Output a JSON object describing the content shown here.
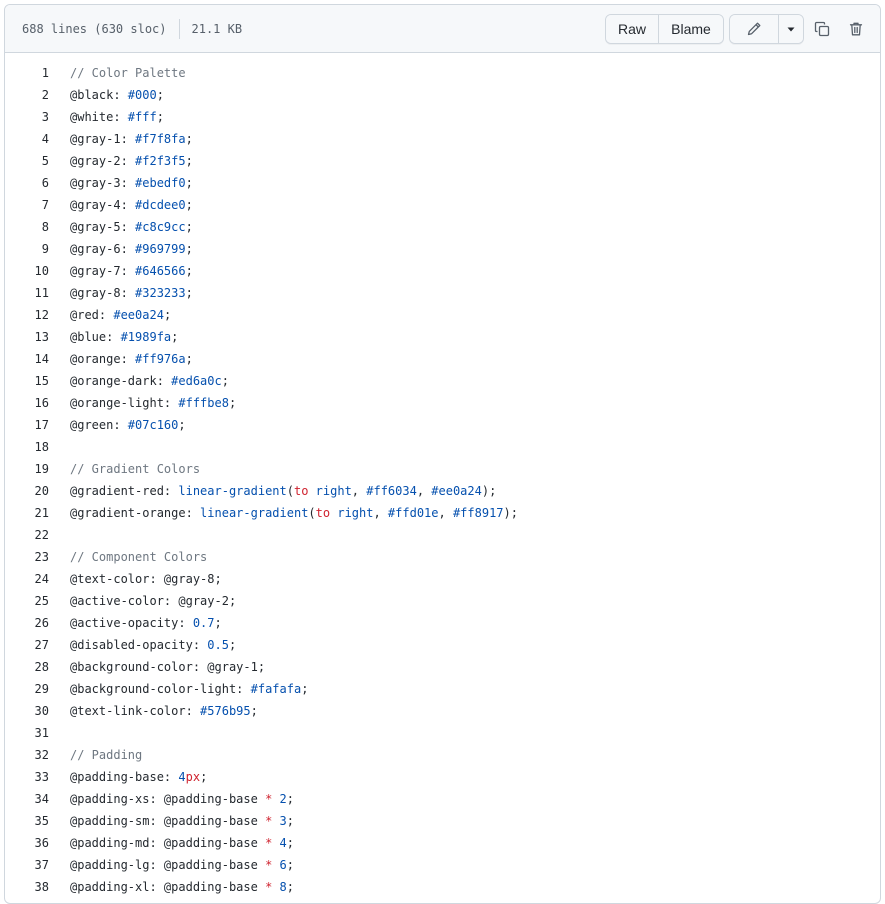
{
  "file_info": {
    "lines": "688 lines (630 sloc)",
    "size": "21.1 KB"
  },
  "toolbar": {
    "raw_label": "Raw",
    "blame_label": "Blame",
    "edit_icon": "pencil-icon",
    "more_icon": "triangle-down-icon",
    "copy_icon": "copy-icon",
    "delete_icon": "trash-icon"
  },
  "code_lines": [
    {
      "n": "1",
      "tokens": [
        {
          "t": "// Color Palette",
          "k": "c"
        }
      ]
    },
    {
      "n": "2",
      "tokens": [
        {
          "t": "@black: ",
          "k": "v"
        },
        {
          "t": "#000",
          "k": "n"
        },
        {
          "t": ";",
          "k": "v"
        }
      ]
    },
    {
      "n": "3",
      "tokens": [
        {
          "t": "@white: ",
          "k": "v"
        },
        {
          "t": "#fff",
          "k": "n"
        },
        {
          "t": ";",
          "k": "v"
        }
      ]
    },
    {
      "n": "4",
      "tokens": [
        {
          "t": "@gray-1: ",
          "k": "v"
        },
        {
          "t": "#f7f8fa",
          "k": "n"
        },
        {
          "t": ";",
          "k": "v"
        }
      ]
    },
    {
      "n": "5",
      "tokens": [
        {
          "t": "@gray-2: ",
          "k": "v"
        },
        {
          "t": "#f2f3f5",
          "k": "n"
        },
        {
          "t": ";",
          "k": "v"
        }
      ]
    },
    {
      "n": "6",
      "tokens": [
        {
          "t": "@gray-3: ",
          "k": "v"
        },
        {
          "t": "#ebedf0",
          "k": "n"
        },
        {
          "t": ";",
          "k": "v"
        }
      ]
    },
    {
      "n": "7",
      "tokens": [
        {
          "t": "@gray-4: ",
          "k": "v"
        },
        {
          "t": "#dcdee0",
          "k": "n"
        },
        {
          "t": ";",
          "k": "v"
        }
      ]
    },
    {
      "n": "8",
      "tokens": [
        {
          "t": "@gray-5: ",
          "k": "v"
        },
        {
          "t": "#c8c9cc",
          "k": "n"
        },
        {
          "t": ";",
          "k": "v"
        }
      ]
    },
    {
      "n": "9",
      "tokens": [
        {
          "t": "@gray-6: ",
          "k": "v"
        },
        {
          "t": "#969799",
          "k": "n"
        },
        {
          "t": ";",
          "k": "v"
        }
      ]
    },
    {
      "n": "10",
      "tokens": [
        {
          "t": "@gray-7: ",
          "k": "v"
        },
        {
          "t": "#646566",
          "k": "n"
        },
        {
          "t": ";",
          "k": "v"
        }
      ]
    },
    {
      "n": "11",
      "tokens": [
        {
          "t": "@gray-8: ",
          "k": "v"
        },
        {
          "t": "#323233",
          "k": "n"
        },
        {
          "t": ";",
          "k": "v"
        }
      ]
    },
    {
      "n": "12",
      "tokens": [
        {
          "t": "@red: ",
          "k": "v"
        },
        {
          "t": "#ee0a24",
          "k": "n"
        },
        {
          "t": ";",
          "k": "v"
        }
      ]
    },
    {
      "n": "13",
      "tokens": [
        {
          "t": "@blue: ",
          "k": "v"
        },
        {
          "t": "#1989fa",
          "k": "n"
        },
        {
          "t": ";",
          "k": "v"
        }
      ]
    },
    {
      "n": "14",
      "tokens": [
        {
          "t": "@orange: ",
          "k": "v"
        },
        {
          "t": "#ff976a",
          "k": "n"
        },
        {
          "t": ";",
          "k": "v"
        }
      ]
    },
    {
      "n": "15",
      "tokens": [
        {
          "t": "@orange-dark: ",
          "k": "v"
        },
        {
          "t": "#ed6a0c",
          "k": "n"
        },
        {
          "t": ";",
          "k": "v"
        }
      ]
    },
    {
      "n": "16",
      "tokens": [
        {
          "t": "@orange-light: ",
          "k": "v"
        },
        {
          "t": "#fffbe8",
          "k": "n"
        },
        {
          "t": ";",
          "k": "v"
        }
      ]
    },
    {
      "n": "17",
      "tokens": [
        {
          "t": "@green: ",
          "k": "v"
        },
        {
          "t": "#07c160",
          "k": "n"
        },
        {
          "t": ";",
          "k": "v"
        }
      ]
    },
    {
      "n": "18",
      "tokens": []
    },
    {
      "n": "19",
      "tokens": [
        {
          "t": "// Gradient Colors",
          "k": "c"
        }
      ]
    },
    {
      "n": "20",
      "tokens": [
        {
          "t": "@gradient-red: ",
          "k": "v"
        },
        {
          "t": "linear-gradient",
          "k": "f"
        },
        {
          "t": "(",
          "k": "v"
        },
        {
          "t": "to",
          "k": "o"
        },
        {
          "t": " ",
          "k": "v"
        },
        {
          "t": "right",
          "k": "f"
        },
        {
          "t": ", ",
          "k": "v"
        },
        {
          "t": "#ff6034",
          "k": "n"
        },
        {
          "t": ", ",
          "k": "v"
        },
        {
          "t": "#ee0a24",
          "k": "n"
        },
        {
          "t": ");",
          "k": "v"
        }
      ]
    },
    {
      "n": "21",
      "tokens": [
        {
          "t": "@gradient-orange: ",
          "k": "v"
        },
        {
          "t": "linear-gradient",
          "k": "f"
        },
        {
          "t": "(",
          "k": "v"
        },
        {
          "t": "to",
          "k": "o"
        },
        {
          "t": " ",
          "k": "v"
        },
        {
          "t": "right",
          "k": "f"
        },
        {
          "t": ", ",
          "k": "v"
        },
        {
          "t": "#ffd01e",
          "k": "n"
        },
        {
          "t": ", ",
          "k": "v"
        },
        {
          "t": "#ff8917",
          "k": "n"
        },
        {
          "t": ");",
          "k": "v"
        }
      ]
    },
    {
      "n": "22",
      "tokens": []
    },
    {
      "n": "23",
      "tokens": [
        {
          "t": "// Component Colors",
          "k": "c"
        }
      ]
    },
    {
      "n": "24",
      "tokens": [
        {
          "t": "@text-color: @gray-8;",
          "k": "v"
        }
      ]
    },
    {
      "n": "25",
      "tokens": [
        {
          "t": "@active-color: @gray-2;",
          "k": "v"
        }
      ]
    },
    {
      "n": "26",
      "tokens": [
        {
          "t": "@active-opacity: ",
          "k": "v"
        },
        {
          "t": "0.7",
          "k": "n"
        },
        {
          "t": ";",
          "k": "v"
        }
      ]
    },
    {
      "n": "27",
      "tokens": [
        {
          "t": "@disabled-opacity: ",
          "k": "v"
        },
        {
          "t": "0.5",
          "k": "n"
        },
        {
          "t": ";",
          "k": "v"
        }
      ]
    },
    {
      "n": "28",
      "tokens": [
        {
          "t": "@background-color: @gray-1;",
          "k": "v"
        }
      ]
    },
    {
      "n": "29",
      "tokens": [
        {
          "t": "@background-color-light: ",
          "k": "v"
        },
        {
          "t": "#fafafa",
          "k": "n"
        },
        {
          "t": ";",
          "k": "v"
        }
      ]
    },
    {
      "n": "30",
      "tokens": [
        {
          "t": "@text-link-color: ",
          "k": "v"
        },
        {
          "t": "#576b95",
          "k": "n"
        },
        {
          "t": ";",
          "k": "v"
        }
      ]
    },
    {
      "n": "31",
      "tokens": []
    },
    {
      "n": "32",
      "tokens": [
        {
          "t": "// Padding",
          "k": "c"
        }
      ]
    },
    {
      "n": "33",
      "tokens": [
        {
          "t": "@padding-base: ",
          "k": "v"
        },
        {
          "t": "4",
          "k": "n"
        },
        {
          "t": "px",
          "k": "o"
        },
        {
          "t": ";",
          "k": "v"
        }
      ]
    },
    {
      "n": "34",
      "tokens": [
        {
          "t": "@padding-xs: @padding-base ",
          "k": "v"
        },
        {
          "t": "*",
          "k": "o"
        },
        {
          "t": " ",
          "k": "v"
        },
        {
          "t": "2",
          "k": "n"
        },
        {
          "t": ";",
          "k": "v"
        }
      ]
    },
    {
      "n": "35",
      "tokens": [
        {
          "t": "@padding-sm: @padding-base ",
          "k": "v"
        },
        {
          "t": "*",
          "k": "o"
        },
        {
          "t": " ",
          "k": "v"
        },
        {
          "t": "3",
          "k": "n"
        },
        {
          "t": ";",
          "k": "v"
        }
      ]
    },
    {
      "n": "36",
      "tokens": [
        {
          "t": "@padding-md: @padding-base ",
          "k": "v"
        },
        {
          "t": "*",
          "k": "o"
        },
        {
          "t": " ",
          "k": "v"
        },
        {
          "t": "4",
          "k": "n"
        },
        {
          "t": ";",
          "k": "v"
        }
      ]
    },
    {
      "n": "37",
      "tokens": [
        {
          "t": "@padding-lg: @padding-base ",
          "k": "v"
        },
        {
          "t": "*",
          "k": "o"
        },
        {
          "t": " ",
          "k": "v"
        },
        {
          "t": "6",
          "k": "n"
        },
        {
          "t": ";",
          "k": "v"
        }
      ]
    },
    {
      "n": "38",
      "tokens": [
        {
          "t": "@padding-xl: @padding-base ",
          "k": "v"
        },
        {
          "t": "*",
          "k": "o"
        },
        {
          "t": " ",
          "k": "v"
        },
        {
          "t": "8",
          "k": "n"
        },
        {
          "t": ";",
          "k": "v"
        }
      ]
    }
  ]
}
